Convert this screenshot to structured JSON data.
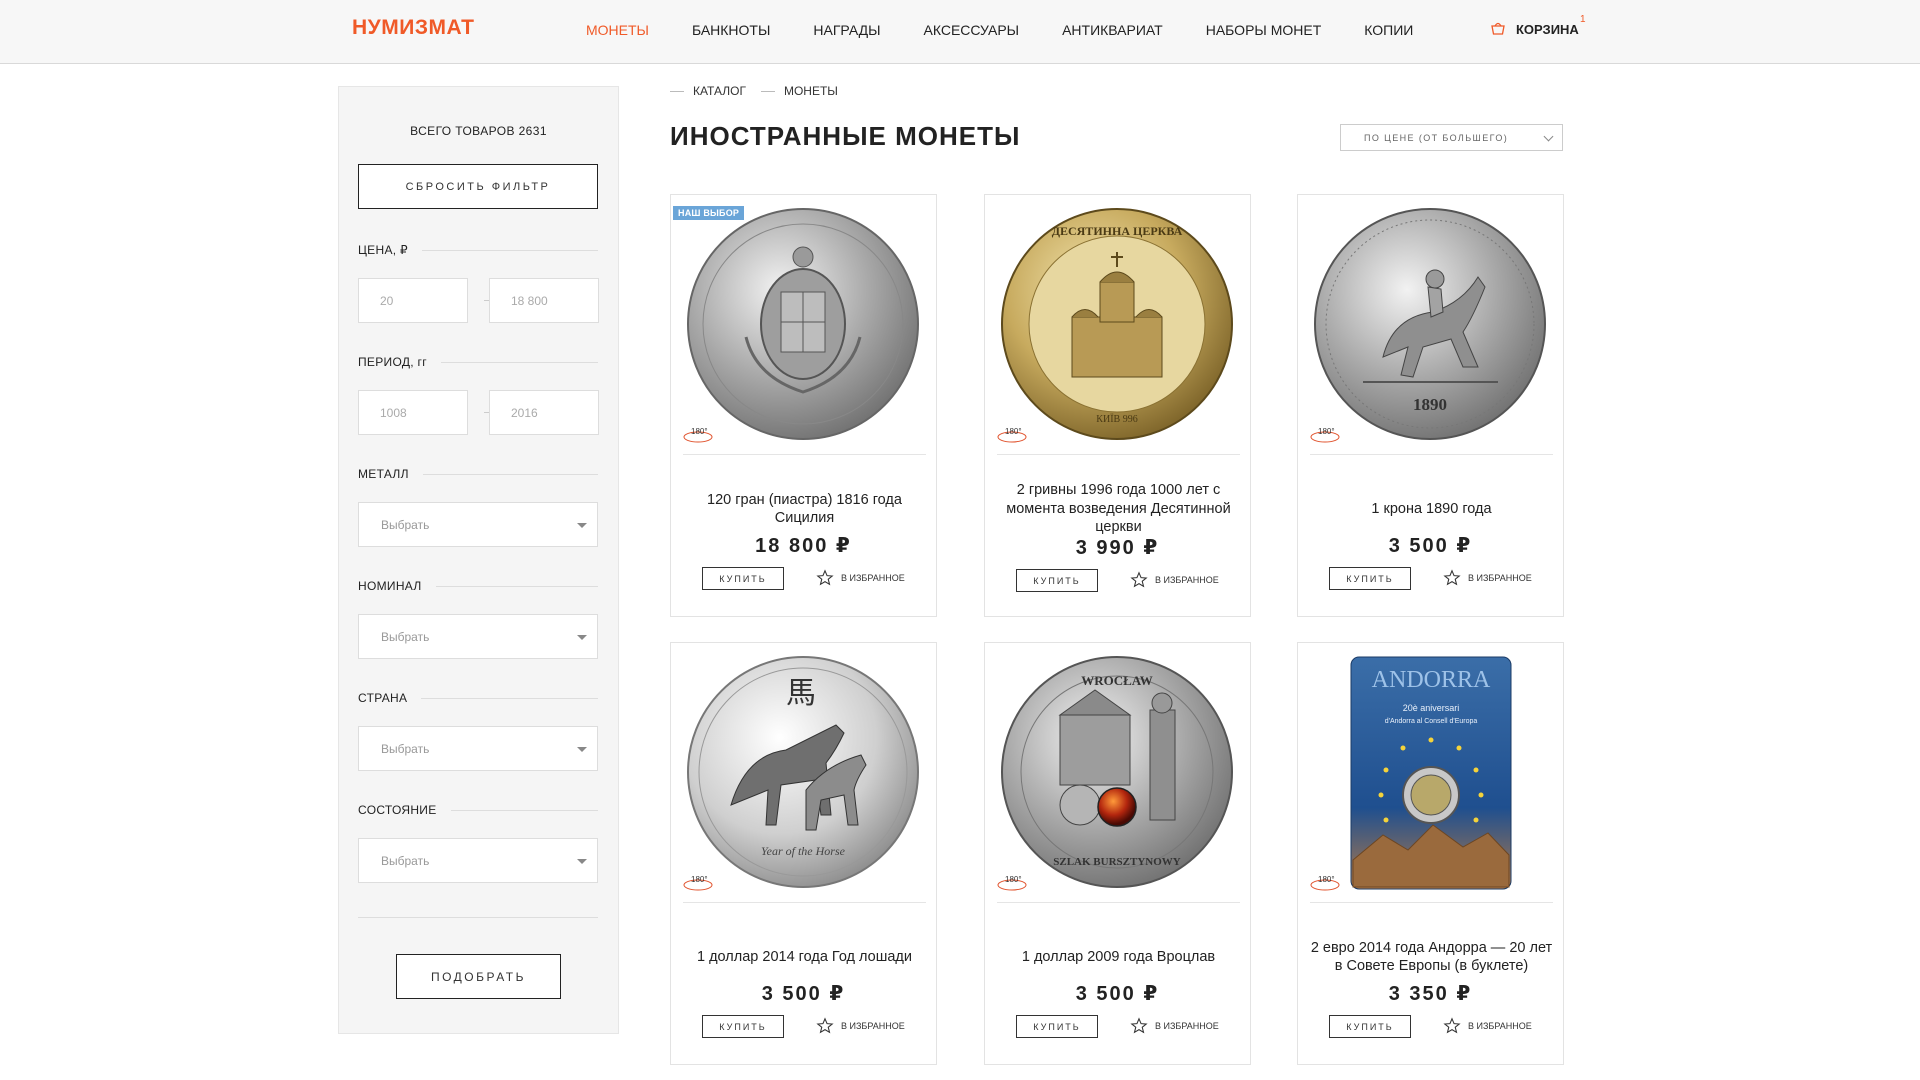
{
  "header": {
    "logo": "НУМИЗМАТ",
    "nav": [
      "МОНЕТЫ",
      "БАНКНОТЫ",
      "НАГРАДЫ",
      "АКСЕССУАРЫ",
      "АНТИКВАРИАТ",
      "НАБОРЫ МОНЕТ",
      "КОПИИ"
    ],
    "active_nav": "МОНЕТЫ",
    "cart_label": "КОРЗИНА",
    "cart_count": "1",
    "cart_icon": "basket-icon"
  },
  "sidebar": {
    "total": "ВСЕГО ТОВАРОВ 2631",
    "reset_label": "СБРОСИТЬ ФИЛЬТР",
    "price": {
      "title": "ЦЕНА, ₽",
      "from": "20",
      "to": "18 800"
    },
    "period": {
      "title": "ПЕРИОД, гг",
      "from": "1008",
      "to": "2016"
    },
    "metal": {
      "title": "МЕТАЛЛ",
      "value": "Выбрать"
    },
    "nominal": {
      "title": "НОМИНАЛ",
      "value": "Выбрать"
    },
    "country": {
      "title": "СТРАНА",
      "value": "Выбрать"
    },
    "condition": {
      "title": "СОСТОЯНИЕ",
      "value": "Выбрать"
    },
    "apply_label": "ПОДОБРАТЬ"
  },
  "content": {
    "breadcrumb": [
      "КАТАЛОГ",
      "МОНЕТЫ"
    ],
    "title": "ИНОСТРАННЫЕ МОНЕТЫ",
    "sort": "ПО ЦЕНЕ (ОТ БОЛЬШЕГО)"
  },
  "products": [
    {
      "title": "120 гран (пиастра) 1816 года Сицилия",
      "price": "18 800 ₽",
      "badge": "НАШ ВЫБОР",
      "image": "silver-coin-crest"
    },
    {
      "title": "2 гривны 1996 года 1000 лет с момента возведения Десятинной церкви",
      "price": "3 990 ₽",
      "badge": "",
      "image": "gold-coin-church"
    },
    {
      "title": "1 крона 1890 года",
      "price": "3 500 ₽",
      "badge": "",
      "image": "silver-coin-st-george"
    },
    {
      "title": "1 доллар 2014 года Год лошади",
      "price": "3 500 ₽",
      "badge": "",
      "image": "silver-coin-horse"
    },
    {
      "title": "1 доллар 2009 года Вроцлав",
      "price": "3 500 ₽",
      "badge": "",
      "image": "silver-coin-amber"
    },
    {
      "title": "2 евро 2014 года Андорра — 20 лет в Совете Европы (в буклете)",
      "price": "3 350 ₽",
      "badge": "",
      "image": "coin-booklet-andorra"
    }
  ],
  "card_labels": {
    "buy": "КУПИТЬ",
    "favorite": "В ИЗБРАННОЕ",
    "rotate": "180°"
  },
  "coin_texts": {
    "church": "ДЕСЯТИННА ЦЕРКВА",
    "church_year": "КИЇВ 996",
    "crown_year": "1890",
    "horse_char": "馬",
    "horse_text": "Year of the Horse",
    "wroclaw": "WROCŁAW",
    "wroclaw_bottom": "SZLAK BURSZTYNOWY",
    "andorra": "ANDORRA",
    "andorra_sub": "20è aniversari",
    "andorra_sub2": "d'Andorra al Consell d'Europa"
  },
  "colors": {
    "accent": "#f05a28",
    "badge": "#6aa5d8"
  }
}
